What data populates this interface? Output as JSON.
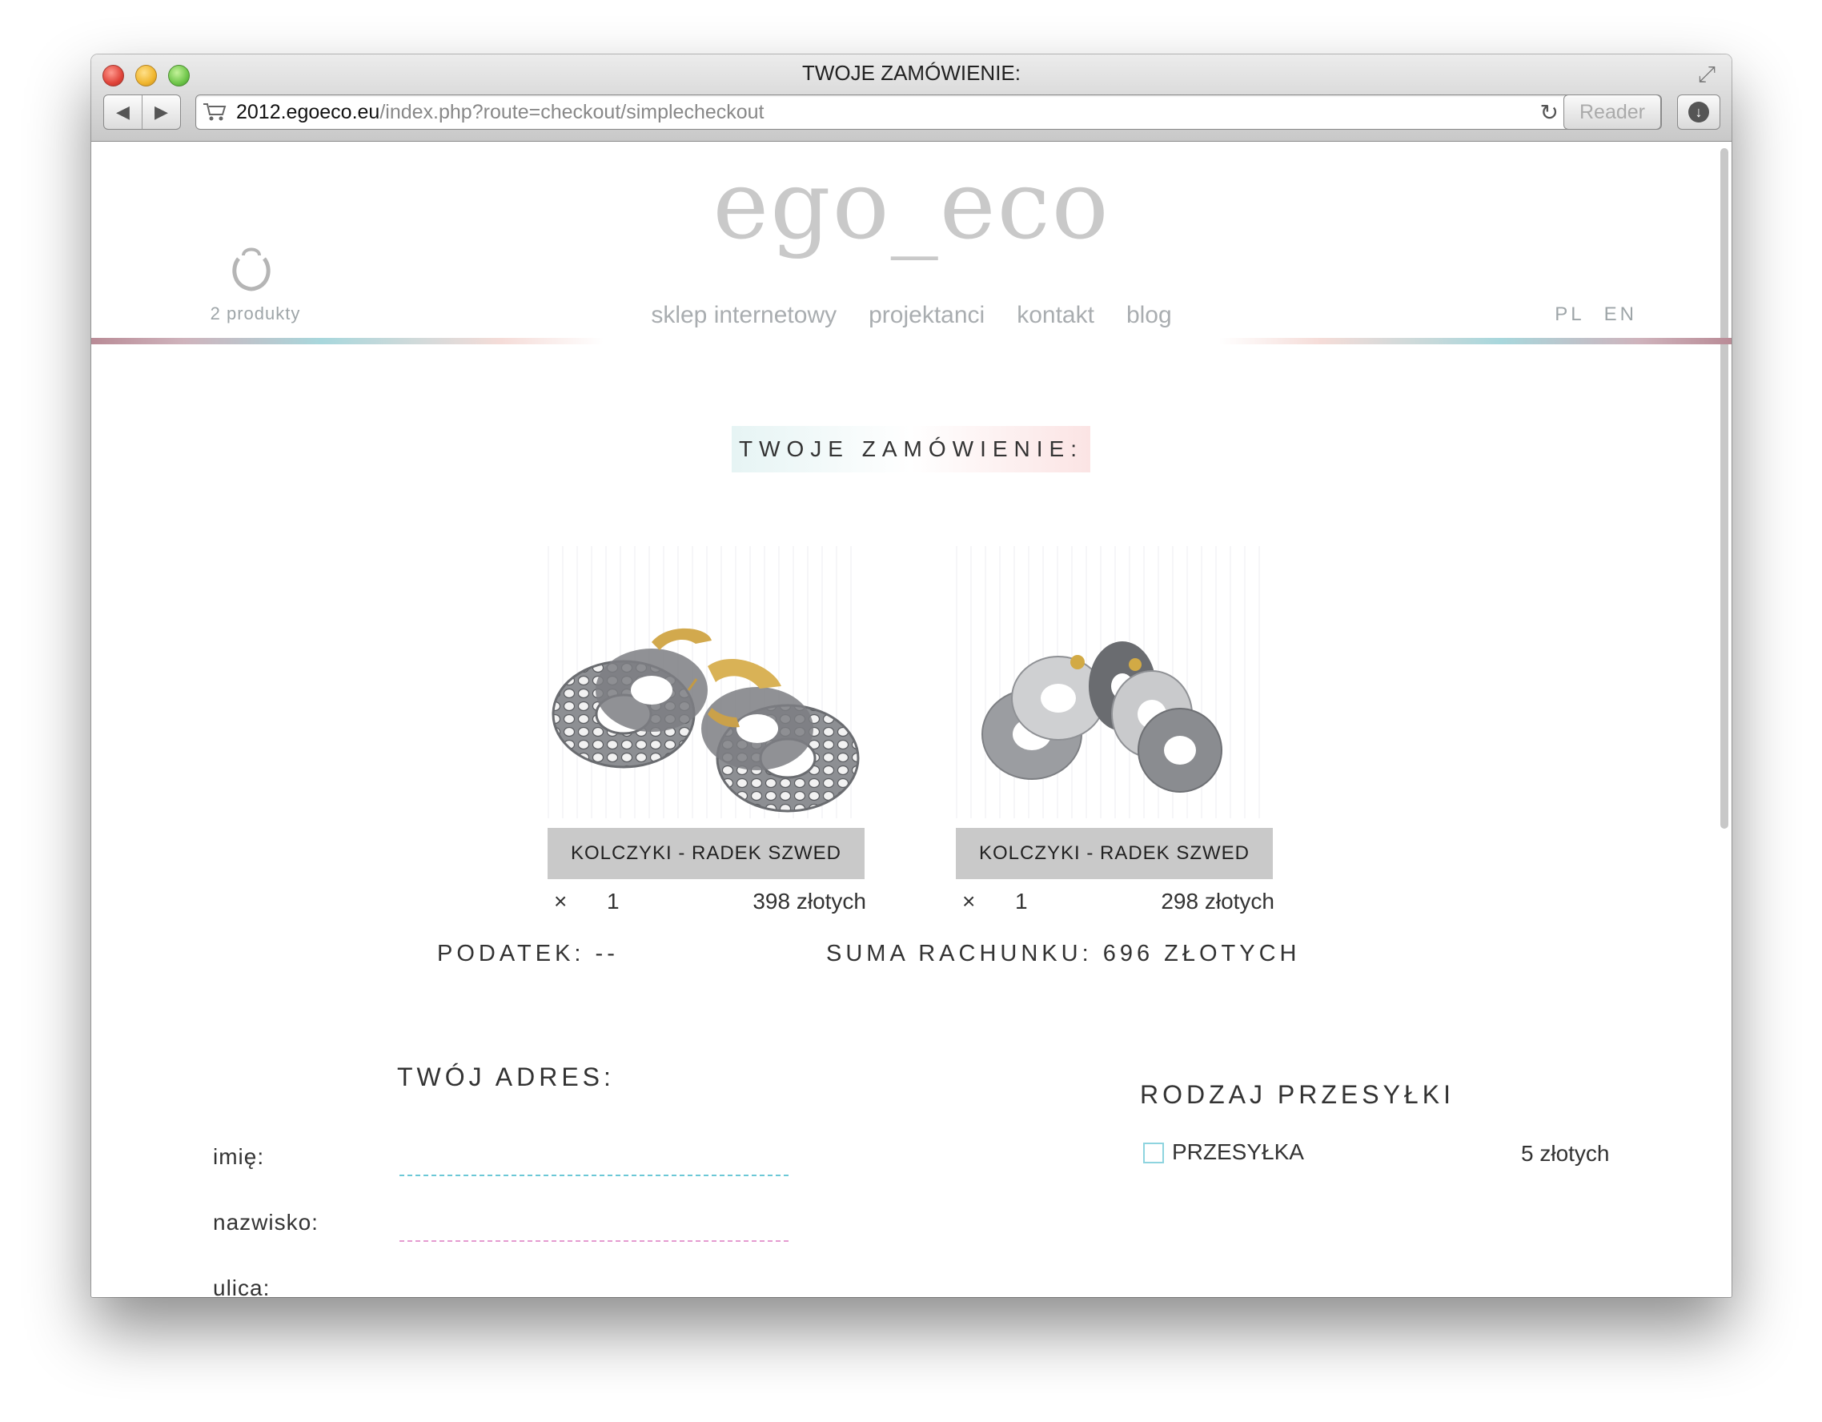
{
  "browser": {
    "window_title": "TWOJE ZAMÓWIENIE:",
    "url_host": "2012.egoeco.eu",
    "url_path": "/index.php?route=checkout/simplecheckout",
    "reader_label": "Reader"
  },
  "header": {
    "logo": "ego_eco",
    "cart_count": "2 produkty",
    "menu": [
      "sklep internetowy",
      "projektanci",
      "kontakt",
      "blog"
    ],
    "languages": [
      "PL",
      "EN"
    ]
  },
  "order": {
    "title": "TWOJE ZAMÓWIENIE:",
    "products": [
      {
        "name": "KOLCZYKI - RADEK SZWED",
        "remove": "×",
        "qty": "1",
        "price": "398 złotych"
      },
      {
        "name": "KOLCZYKI - RADEK SZWED",
        "remove": "×",
        "qty": "1",
        "price": "298 złotych"
      }
    ],
    "tax": "PODATEK: --",
    "total": "SUMA RACHUNKU: 696 ZŁOTYCH"
  },
  "address": {
    "title": "TWÓJ ADRES:",
    "fields": [
      {
        "label": "imię:",
        "color": "#6cc8d6"
      },
      {
        "label": "nazwisko:",
        "color": "#e59bd0"
      },
      {
        "label": "ulica:",
        "color": "#e0304a"
      }
    ]
  },
  "shipping": {
    "title": "RODZAJ PRZESYŁKI",
    "option_label": "PRZESYŁKA",
    "option_price": "5 złotych"
  }
}
